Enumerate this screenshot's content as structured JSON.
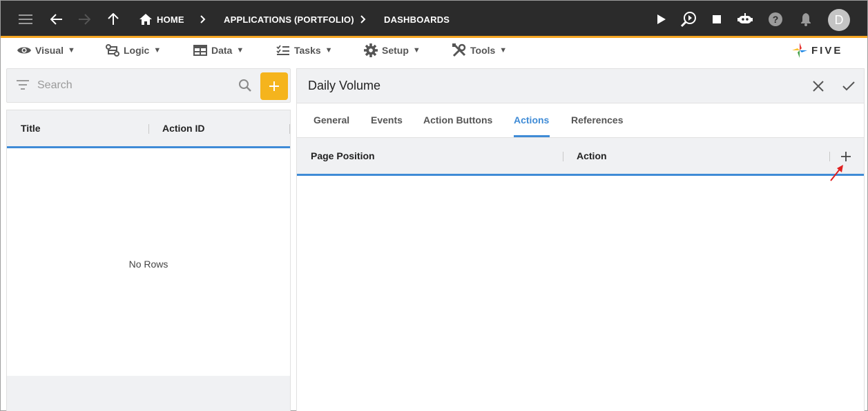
{
  "appbar": {
    "breadcrumbs": [
      "HOME",
      "APPLICATIONS (PORTFOLIO)",
      "DASHBOARDS"
    ],
    "avatar_initial": "D"
  },
  "menubar": {
    "items": [
      {
        "label": "Visual",
        "icon": "eye-icon"
      },
      {
        "label": "Logic",
        "icon": "logic-icon"
      },
      {
        "label": "Data",
        "icon": "table-icon"
      },
      {
        "label": "Tasks",
        "icon": "checklist-icon"
      },
      {
        "label": "Setup",
        "icon": "gear-icon"
      },
      {
        "label": "Tools",
        "icon": "tools-icon"
      }
    ],
    "dropdown_glyph": "▼",
    "logo_text": "FIVE"
  },
  "left": {
    "search_placeholder": "Search",
    "columns": [
      "Title",
      "Action ID"
    ],
    "empty_text": "No Rows"
  },
  "form": {
    "title": "Daily Volume",
    "tabs": [
      "General",
      "Events",
      "Action Buttons",
      "Actions",
      "References"
    ],
    "active_tab": "Actions",
    "grid_columns": [
      "Page Position",
      "Action"
    ]
  },
  "colors": {
    "appbar_bg": "#2b2b2b",
    "accent_orange": "#f5a623",
    "add_button": "#f5b41d",
    "active_blue": "#3f8bd6",
    "annotation_arrow": "#e02020"
  }
}
